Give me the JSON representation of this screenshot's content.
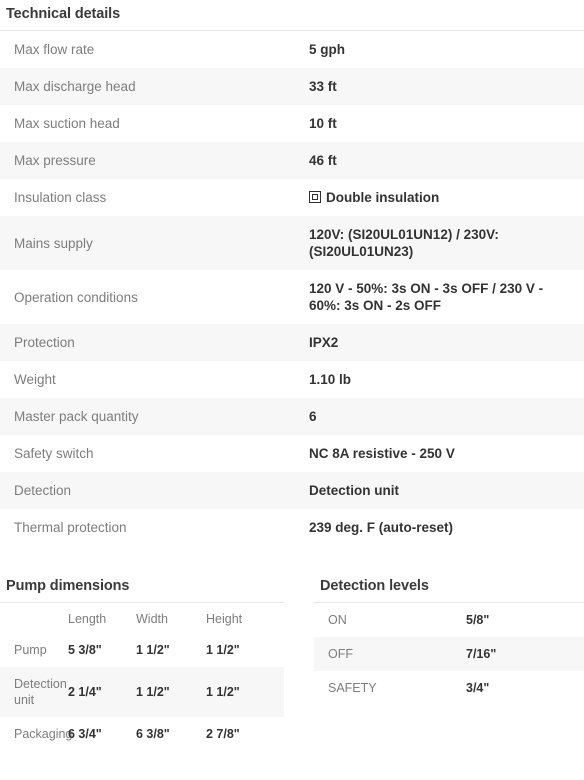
{
  "technical": {
    "heading": "Technical details",
    "rows": [
      {
        "label": "Max flow rate",
        "value": "5 gph"
      },
      {
        "label": "Max discharge head",
        "value": "33 ft"
      },
      {
        "label": "Max suction head",
        "value": "10 ft"
      },
      {
        "label": "Max pressure",
        "value": "46 ft"
      },
      {
        "label": "Insulation class",
        "value": "Double insulation",
        "icon": "double-insulation-icon"
      },
      {
        "label": "Mains supply",
        "value": "120V: (SI20UL01UN12) / 230V: (SI20UL01UN23)"
      },
      {
        "label": "Operation conditions",
        "value": "120 V - 50%: 3s ON - 3s OFF / 230 V - 60%: 3s ON - 2s OFF"
      },
      {
        "label": "Protection",
        "value": "IPX2"
      },
      {
        "label": "Weight",
        "value": "1.10 lb"
      },
      {
        "label": "Master pack quantity",
        "value": "6"
      },
      {
        "label": "Safety switch",
        "value": "NC 8A resistive - 250 V"
      },
      {
        "label": "Detection",
        "value": "Detection unit"
      },
      {
        "label": "Thermal protection",
        "value": "239 deg. F (auto-reset)"
      }
    ]
  },
  "pump_dimensions": {
    "heading": "Pump dimensions",
    "columns": [
      "",
      "Length",
      "Width",
      "Height"
    ],
    "rows": [
      {
        "label": "Pump",
        "length": "5 3/8\"",
        "width": "1 1/2\"",
        "height": "1 1/2\""
      },
      {
        "label": "Detection unit",
        "length": "2 1/4\"",
        "width": "1 1/2\"",
        "height": "1 1/2\""
      },
      {
        "label": "Packaging",
        "length": "6 3/4\"",
        "width": "6 3/8\"",
        "height": "2 7/8\""
      }
    ]
  },
  "detection_levels": {
    "heading": "Detection levels",
    "rows": [
      {
        "label": "ON",
        "value": "5/8\""
      },
      {
        "label": "OFF",
        "value": "7/16\""
      },
      {
        "label": "SAFETY",
        "value": "3/4\""
      }
    ]
  },
  "colors": {
    "row_alt_background": "#f7f7f7",
    "label_text": "#7d7d7d",
    "value_text": "#333333",
    "heading_text": "#3a3a3a",
    "divider": "#e6e6e6"
  }
}
